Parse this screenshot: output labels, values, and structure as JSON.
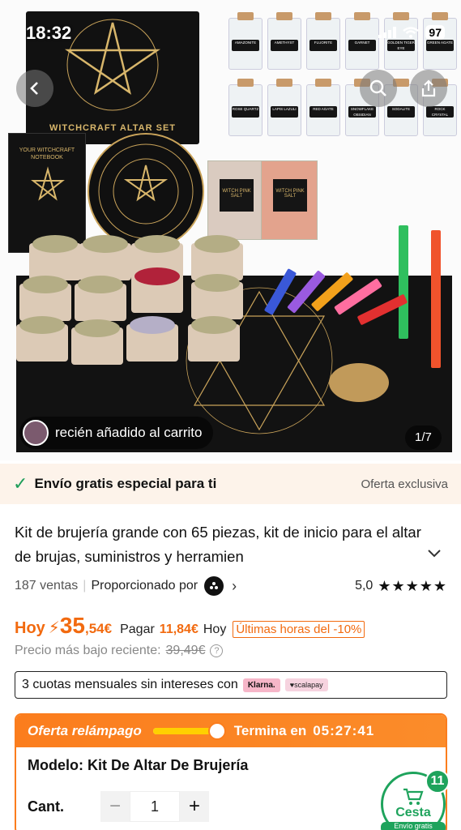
{
  "status": {
    "time": "18:32",
    "battery": "97"
  },
  "hero": {
    "box_title": "WITCHCRAFT ALTAR SET",
    "notebook_title": "YOUR WITCHCRAFT NOTEBOOK",
    "salt_label": "WITCH PINK SALT",
    "jars": [
      "AMAZONITE",
      "AMETHYST",
      "FLUORITE",
      "GARNET",
      "GOLDEN TIGER EYE",
      "GREEN AGATE",
      "ROSE QUARTZ",
      "LAPIS LAZULI",
      "RED AGATE",
      "SNOWFLAKE OBSIDIAN",
      "SODALITE",
      "ROCK CRYSTAL"
    ],
    "cart_notice": "recién añadido al carrito",
    "counter": "1/7"
  },
  "shipping": {
    "text": "Envío gratis especial para ti",
    "offer": "Oferta exclusiva"
  },
  "product": {
    "title": "Kit de brujería grande con 65 piezas, kit de inicio para el altar de brujas, suministros y herramien",
    "sales": "187 ventas",
    "provided_by": "Proporcionado por",
    "rating": "5,0",
    "stars": "★★★★★"
  },
  "price": {
    "prefix": "Hoy",
    "bolt": "⚡",
    "integer": "35",
    "decimal": ",54€",
    "pay_label": "Pagar",
    "pay_amount": "11,84€",
    "pay_when": "Hoy",
    "badge": "Últimas horas del -10%",
    "lowest_label": "Precio más bajo reciente:",
    "lowest_value": "39,49€"
  },
  "installments": {
    "text": "3 cuotas mensuales sin intereses con",
    "klarna": "Klarna.",
    "scalapay": "♥scalapay"
  },
  "flash": {
    "title": "Oferta relámpago",
    "progress": 0.85,
    "ends_label": "Termina en",
    "timer": "05:27:41",
    "model": "Modelo: Kit De Altar De Brujería",
    "qty_label": "Cant.",
    "qty_value": "1",
    "minus": "−",
    "plus": "+"
  },
  "cart": {
    "label": "Cesta",
    "count": "11",
    "shipping": "Envío gratis"
  },
  "colors": {
    "accent": "#f26a0f",
    "flash": "#fb7d1d",
    "green": "#1ea35c"
  }
}
